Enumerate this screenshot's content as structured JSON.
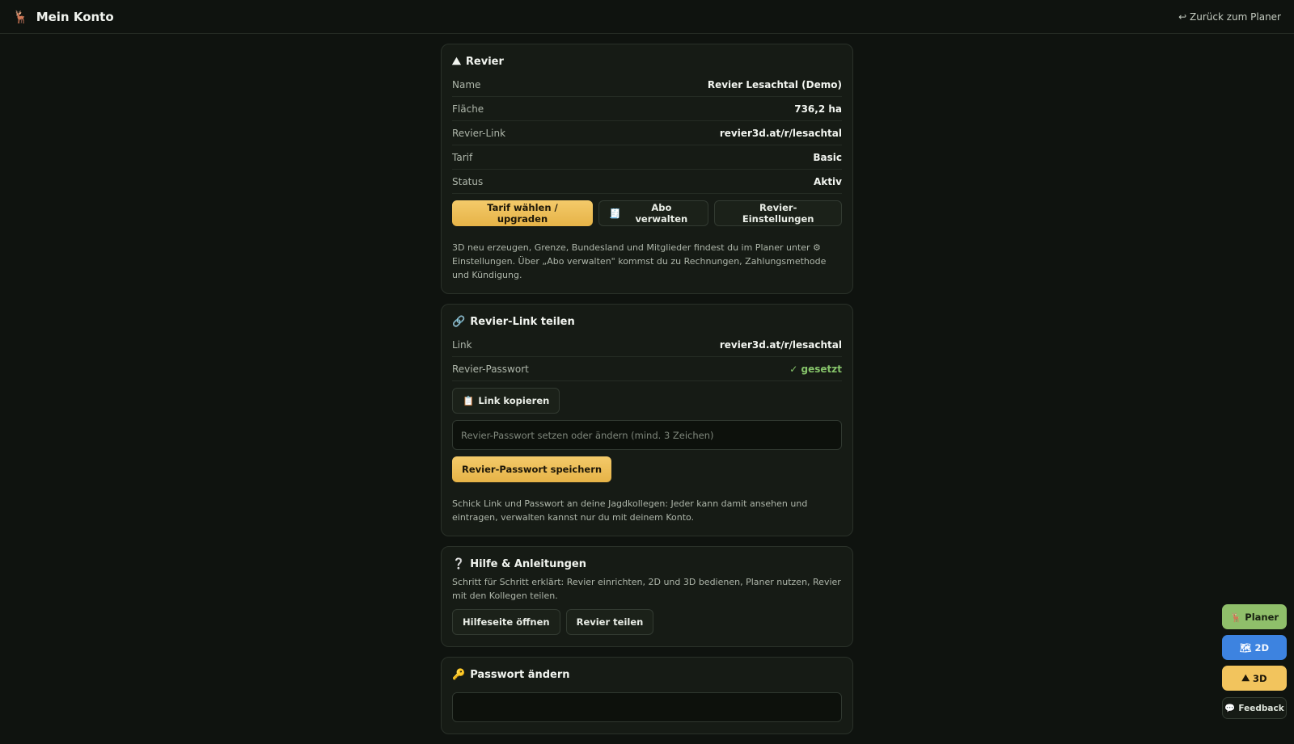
{
  "header": {
    "logo_icon": "deer-icon",
    "title": "Mein Konto",
    "back_label": "↩ Zurück zum Planer"
  },
  "revier": {
    "icon": "mountain-icon",
    "title": "Revier",
    "rows": [
      {
        "label": "Name",
        "value": "Revier Lesachtal (Demo)"
      },
      {
        "label": "Fläche",
        "value": "736,2 ha"
      },
      {
        "label": "Revier-Link",
        "value": "revier3d.at/r/lesachtal"
      },
      {
        "label": "Tarif",
        "value": "Basic"
      },
      {
        "label": "Status",
        "value": "Aktiv"
      }
    ],
    "buttons": {
      "upgrade": "Tarif wählen / upgraden",
      "abo": "Abo verwalten",
      "settings": "Revier-Einstellungen"
    },
    "note": "3D neu erzeugen, Grenze, Bundesland und Mitglieder findest du im Planer unter ⚙ Einstellungen. Über „Abo verwalten\" kommst du zu Rechnungen, Zahlungsmethode und Kündigung."
  },
  "share": {
    "icon": "link-icon",
    "title": "Revier-Link teilen",
    "rows": [
      {
        "label": "Link",
        "value": "revier3d.at/r/lesachtal"
      },
      {
        "label": "Revier-Passwort",
        "value": "✓ gesetzt"
      }
    ],
    "copy_label": "Link kopieren",
    "password_placeholder": "Revier-Passwort setzen oder ändern (mind. 3 Zeichen)",
    "save_label": "Revier-Passwort speichern",
    "note": "Schick Link und Passwort an deine Jagdkollegen: Jeder kann damit ansehen und eintragen, verwalten kannst nur du mit deinem Konto."
  },
  "help": {
    "icon": "question-icon",
    "title": "Hilfe & Anleitungen",
    "note": "Schritt für Schritt erklärt: Revier einrichten, 2D und 3D bedienen, Planer nutzen, Revier mit den Kollegen teilen.",
    "open_label": "Hilfeseite öffnen",
    "share_label": "Revier teilen"
  },
  "password": {
    "icon": "key-icon",
    "title": "Passwort ändern"
  },
  "fabs": {
    "planer": "Planer",
    "two_d": "2D",
    "three_d": "3D",
    "feedback": "Feedback"
  }
}
